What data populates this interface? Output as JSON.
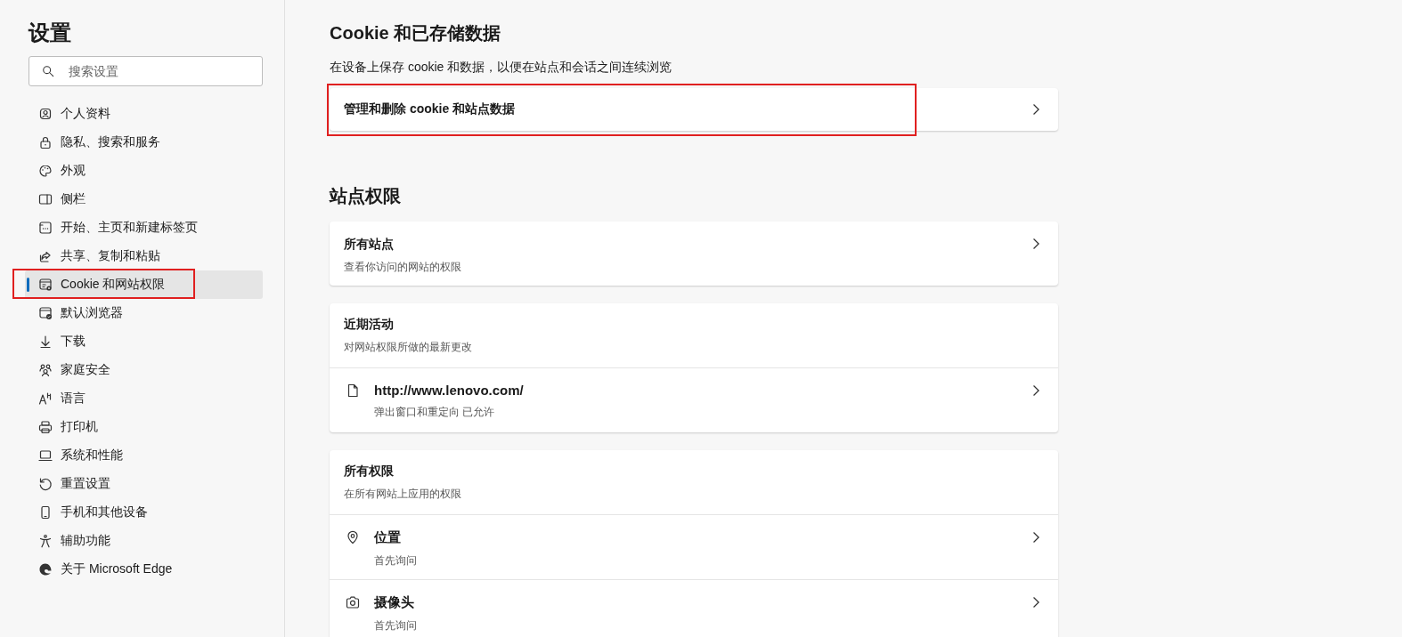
{
  "sidebar": {
    "title": "设置",
    "search": {
      "placeholder": "搜索设置"
    },
    "items": [
      {
        "label": "个人资料",
        "selected": false,
        "highlighted": false
      },
      {
        "label": "隐私、搜索和服务",
        "selected": false,
        "highlighted": false
      },
      {
        "label": "外观",
        "selected": false,
        "highlighted": false
      },
      {
        "label": "侧栏",
        "selected": false,
        "highlighted": false
      },
      {
        "label": "开始、主页和新建标签页",
        "selected": false,
        "highlighted": false
      },
      {
        "label": "共享、复制和粘贴",
        "selected": false,
        "highlighted": false
      },
      {
        "label": "Cookie 和网站权限",
        "selected": true,
        "highlighted": true
      },
      {
        "label": "默认浏览器",
        "selected": false,
        "highlighted": false
      },
      {
        "label": "下载",
        "selected": false,
        "highlighted": false
      },
      {
        "label": "家庭安全",
        "selected": false,
        "highlighted": false
      },
      {
        "label": "语言",
        "selected": false,
        "highlighted": false
      },
      {
        "label": "打印机",
        "selected": false,
        "highlighted": false
      },
      {
        "label": "系统和性能",
        "selected": false,
        "highlighted": false
      },
      {
        "label": "重置设置",
        "selected": false,
        "highlighted": false
      },
      {
        "label": "手机和其他设备",
        "selected": false,
        "highlighted": false
      },
      {
        "label": "辅助功能",
        "selected": false,
        "highlighted": false
      },
      {
        "label": "关于 Microsoft Edge",
        "selected": false,
        "highlighted": false
      }
    ]
  },
  "main": {
    "storage": {
      "heading": "Cookie 和已存储数据",
      "description": "在设备上保存 cookie 和数据，以便在站点和会话之间连续浏览",
      "link": {
        "label": "管理和删除 cookie 和站点数据",
        "highlighted": true
      }
    },
    "permissions": {
      "heading": "站点权限",
      "cards": [
        {
          "kind": "link",
          "title": "所有站点",
          "subtitle": "查看你访问的网站的权限"
        },
        {
          "kind": "group",
          "title": "近期活动",
          "subtitle": "对网站权限所做的最新更改",
          "rows": [
            {
              "title": "http://www.lenovo.com/",
              "subtitle": "弹出窗口和重定向 已允许"
            }
          ]
        },
        {
          "kind": "group",
          "title": "所有权限",
          "subtitle": "在所有网站上应用的权限",
          "rows": [
            {
              "title": "位置",
              "subtitle": "首先询问"
            },
            {
              "title": "摄像头",
              "subtitle": "首先询问"
            }
          ]
        }
      ]
    }
  }
}
